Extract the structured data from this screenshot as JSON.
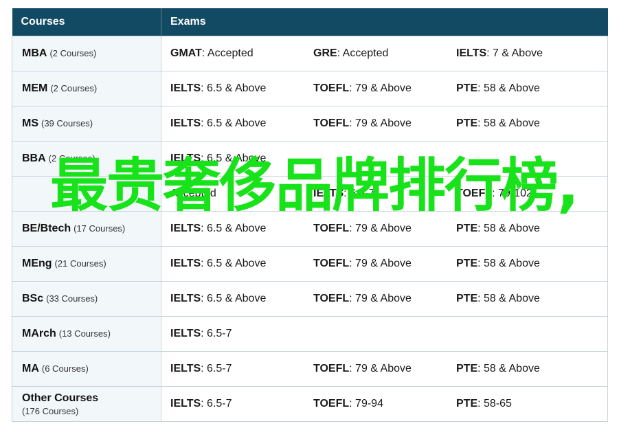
{
  "header": {
    "courses": "Courses",
    "exams": "Exams"
  },
  "rows": [
    {
      "name": "MBA",
      "count": "(2 Courses)",
      "exams": [
        {
          "name": "GMAT",
          "value": ": Accepted"
        },
        {
          "name": "GRE",
          "value": ": Accepted"
        },
        {
          "name": "IELTS",
          "value": ": 7 & Above"
        }
      ]
    },
    {
      "name": "MEM",
      "count": "(2 Courses)",
      "exams": [
        {
          "name": "IELTS",
          "value": ": 6.5 & Above"
        },
        {
          "name": "TOEFL",
          "value": ": 79 & Above"
        },
        {
          "name": "PTE",
          "value": ": 58 & Above"
        }
      ]
    },
    {
      "name": "MS",
      "count": "(39 Courses)",
      "exams": [
        {
          "name": "IELTS",
          "value": ": 6.5 & Above"
        },
        {
          "name": "TOEFL",
          "value": ": 79 & Above"
        },
        {
          "name": "PTE",
          "value": ": 58 & Above"
        }
      ]
    },
    {
      "name": "BBA",
      "count": "(2 Courses)",
      "exams": [
        {
          "name": "IELTS",
          "value": ": 6.5 & Above"
        },
        {
          "name": "",
          "value": ""
        },
        {
          "name": "",
          "value": ""
        }
      ]
    },
    {
      "name": "",
      "count": "",
      "exams": [
        {
          "name": "",
          "value": "Accepted"
        },
        {
          "name": "IELTS",
          "value": ": 6.5-7"
        },
        {
          "name": "TOEFL",
          "value": ": 79-102"
        }
      ]
    },
    {
      "name": "BE/Btech",
      "count": "(17 Courses)",
      "exams": [
        {
          "name": "IELTS",
          "value": ": 6.5 & Above"
        },
        {
          "name": "TOEFL",
          "value": ": 79 & Above"
        },
        {
          "name": "PTE",
          "value": ": 58 & Above"
        }
      ]
    },
    {
      "name": "MEng",
      "count": "(21 Courses)",
      "exams": [
        {
          "name": "IELTS",
          "value": ": 6.5 & Above"
        },
        {
          "name": "TOEFL",
          "value": ": 79 & Above"
        },
        {
          "name": "PTE",
          "value": ": 58 & Above"
        }
      ]
    },
    {
      "name": "BSc",
      "count": "(33 Courses)",
      "exams": [
        {
          "name": "IELTS",
          "value": ": 6.5 & Above"
        },
        {
          "name": "TOEFL",
          "value": ": 79 & Above"
        },
        {
          "name": "PTE",
          "value": ": 58 & Above"
        }
      ]
    },
    {
      "name": "MArch",
      "count": "(13 Courses)",
      "exams": [
        {
          "name": "IELTS",
          "value": ": 6.5-7"
        },
        {
          "name": "",
          "value": ""
        },
        {
          "name": "",
          "value": ""
        }
      ]
    },
    {
      "name": "MA",
      "count": "(6 Courses)",
      "exams": [
        {
          "name": "IELTS",
          "value": ": 6.5-7"
        },
        {
          "name": "TOEFL",
          "value": ": 79 & Above"
        },
        {
          "name": "PTE",
          "value": ": 58 & Above"
        }
      ]
    },
    {
      "name": "Other Courses",
      "count": "(176 Courses)",
      "exams": [
        {
          "name": "IELTS",
          "value": ": 6.5-7"
        },
        {
          "name": "TOEFL",
          "value": ": 79-94"
        },
        {
          "name": "PTE",
          "value": ": 58-65"
        }
      ]
    }
  ],
  "overlay_text": "最贵奢侈品牌排行榜,",
  "colors": {
    "header_bg": "#134a63",
    "overlay": "#18e21a",
    "course_cell_bg": "#f2f7fa"
  }
}
